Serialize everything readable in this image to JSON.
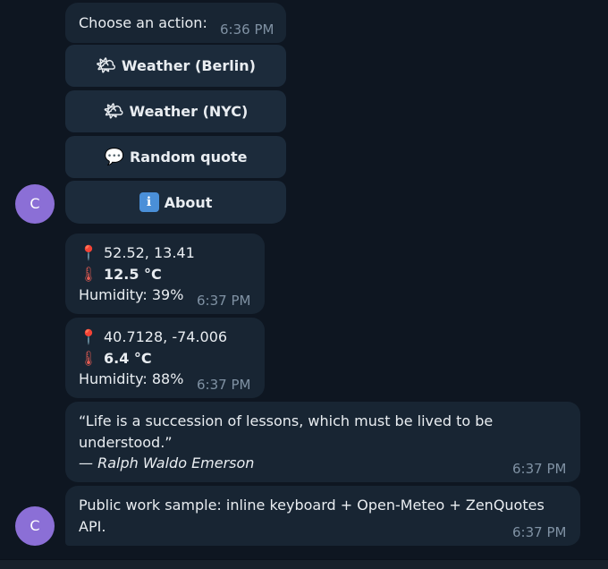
{
  "menu_message": {
    "text": "Choose an action:",
    "time": "6:36 PM"
  },
  "keyboard": [
    {
      "icon": "🌤",
      "icon_name": "sun-behind-cloud-icon",
      "label": "Weather (Berlin)"
    },
    {
      "icon": "🌤",
      "icon_name": "sun-behind-cloud-icon",
      "label": "Weather (NYC)"
    },
    {
      "icon": "💬",
      "icon_name": "speech-bubble-icon",
      "label": "Random quote"
    },
    {
      "icon": "ℹ",
      "icon_name": "info-icon",
      "label": "About"
    }
  ],
  "avatar_letter": "C",
  "weather_berlin": {
    "coords": "52.52, 13.41",
    "temp": "12.5 °C",
    "humidity": "Humidity: 39%",
    "time": "6:37 PM"
  },
  "weather_nyc": {
    "coords": "40.7128, -74.006",
    "temp": "6.4 °C",
    "humidity": "Humidity: 88%",
    "time": "6:37 PM"
  },
  "quote": {
    "line1": "“Life is a succession of lessons, which must be lived to be",
    "line2": "understood.”",
    "author": "— Ralph Waldo Emerson",
    "time": "6:37 PM"
  },
  "about": {
    "line1": "Public work sample: inline keyboard + Open-Meteo + ZenQuotes",
    "line2": "API.",
    "time": "6:37 PM"
  },
  "icons": {
    "pin": "📍",
    "thermometer": "🌡"
  },
  "colors": {
    "background": "#0e1621",
    "bubble": "#182533",
    "avatar": "#8b6fd6",
    "timestamp": "#7f91a3"
  }
}
